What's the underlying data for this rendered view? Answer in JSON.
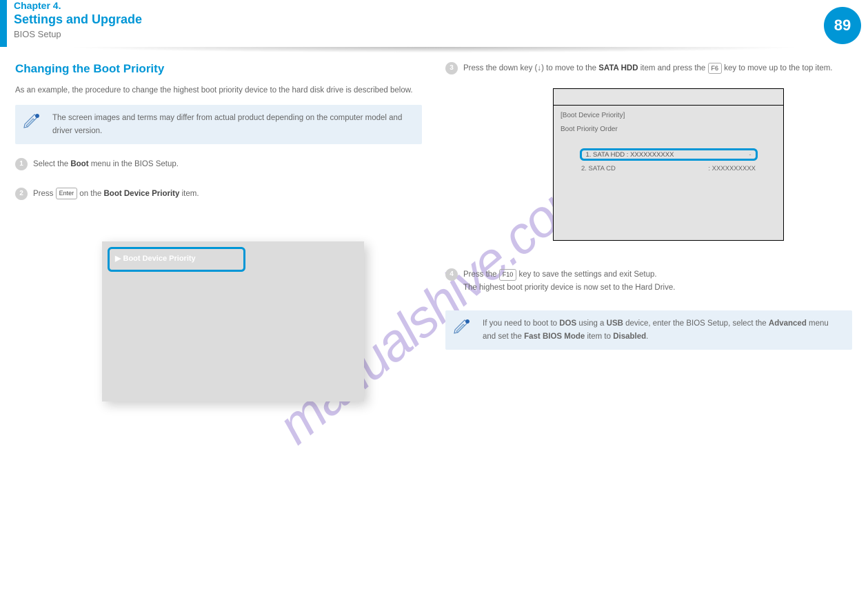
{
  "header": {
    "chapter_num": "Chapter 4.",
    "chapter_title": "Settings and Upgrade",
    "section_title": "BIOS Setup",
    "page_number": "89"
  },
  "left": {
    "heading": "Changing the Boot Priority",
    "intro": "As an example, the procedure to change the highest boot priority device to the hard disk drive is described below.",
    "note": "The screen images and terms may differ from actual product depending on the computer model and driver version.",
    "step1_a": "Select the ",
    "step1_b": "Boot",
    "step1_c": " menu in the BIOS Setup.",
    "step2_a": "Press ",
    "step2_b": "Enter",
    "step2_c": " on the ",
    "step2_d": "Boot Device Priority",
    "step2_e": " item.",
    "shot1_item": "▶ Boot Device Priority"
  },
  "right": {
    "step3_a": "Press the down key (↓) to move to the ",
    "step3_b": "SATA HDD",
    "step3_c": " item and press the ",
    "step3_d": "F6",
    "step3_e": " key to move up to the top item.",
    "shot2": {
      "body_line1": "[Boot Device Priority]",
      "body_line2": "Boot Priority Order",
      "row_left": "1. SATA HDD    : XXXXXXXXXX",
      "row_right": "-",
      "row2_left": "2. SATA CD",
      "row2_right": ": XXXXXXXXXX"
    },
    "step4_a": "Press the ",
    "step4_b": "F10",
    "step4_c": " key to save the settings and exit Setup.",
    "step4_d": " The highest boot priority device is now set to the Hard Drive.",
    "note2_a": "If you need to boot to ",
    "note2_b": "DOS",
    "note2_c": " using a ",
    "note2_d": "USB",
    "note2_e": " device, enter the BIOS Setup, select the ",
    "note2_f": "Advanced",
    "note2_g": " menu and set the ",
    "note2_h": "Fast BIOS Mode",
    "note2_i": " item to ",
    "note2_j": "Disabled",
    "note2_k": "."
  },
  "watermark": "manualshive.com"
}
